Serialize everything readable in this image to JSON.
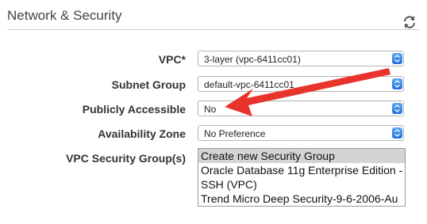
{
  "section": {
    "title": "Network & Security"
  },
  "icons": {
    "refresh": "refresh-icon",
    "dropdown": "chevron-up-down-icon"
  },
  "colors": {
    "annotation_arrow": "#e8342c",
    "select_arrow": "#1f6fe0"
  },
  "form": {
    "vpc": {
      "label": "VPC*",
      "value": "3-layer (vpc-6411cc01)"
    },
    "subnet_group": {
      "label": "Subnet Group",
      "value": "default-vpc-6411cc01"
    },
    "publicly_accessible": {
      "label": "Publicly Accessible",
      "value": "No"
    },
    "availability_zone": {
      "label": "Availability Zone",
      "value": "No Preference"
    },
    "vpc_security_groups": {
      "label": "VPC Security Group(s)",
      "options": [
        {
          "label": "Create new Security Group",
          "selected": true
        },
        {
          "label": "Oracle Database 11g Enterprise Edition -",
          "selected": false
        },
        {
          "label": "SSH (VPC)",
          "selected": false
        },
        {
          "label": "Trend Micro Deep Security-9-6-2006-Au",
          "selected": false
        }
      ]
    }
  }
}
